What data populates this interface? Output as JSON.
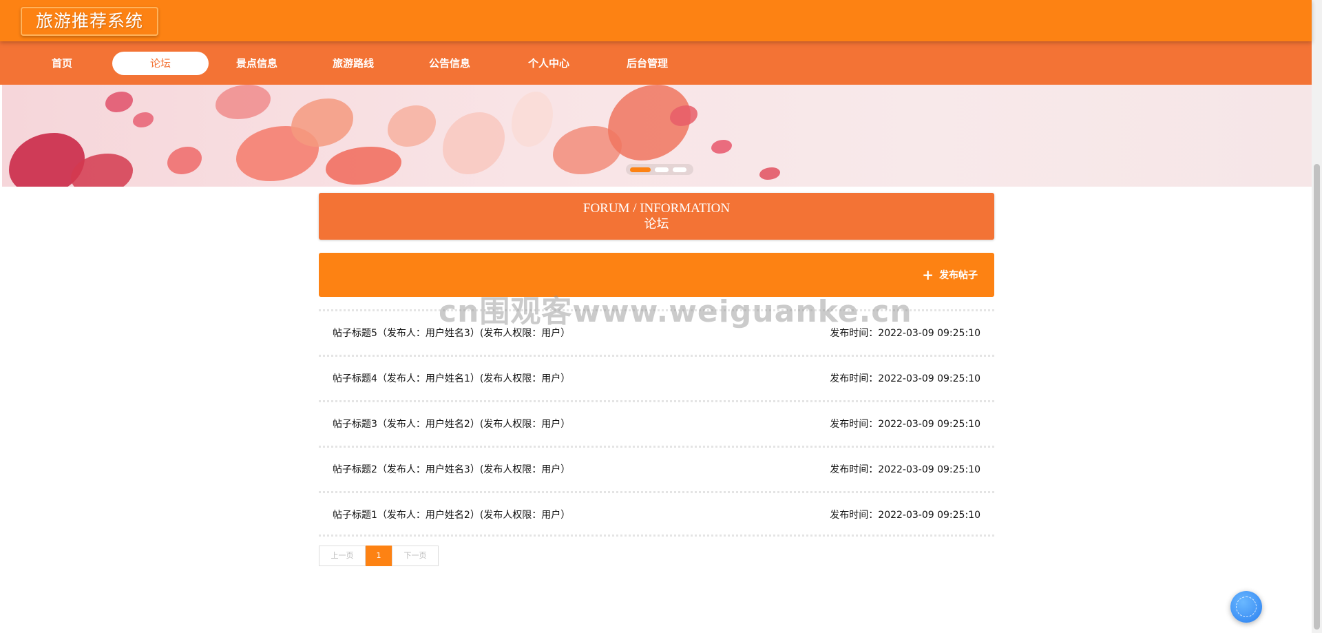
{
  "app": {
    "title": "旅游推荐系统"
  },
  "nav": {
    "items": [
      {
        "label": "首页"
      },
      {
        "label": "论坛"
      },
      {
        "label": "景点信息"
      },
      {
        "label": "旅游路线"
      },
      {
        "label": "公告信息"
      },
      {
        "label": "个人中心"
      },
      {
        "label": "后台管理"
      }
    ],
    "active_index": 1
  },
  "banner": {
    "slide_count": 3,
    "active_slide": 0
  },
  "section": {
    "title_en": "FORUM / INFORMATION",
    "title_cn": "论坛"
  },
  "actions": {
    "publish_label": "发布帖子",
    "publish_icon": "plus-icon"
  },
  "watermark": "cn围观客www.weiguanke.cn",
  "posts": [
    {
      "title": "帖子标题5（发布人：用户姓名3）(发布人权限：用户）",
      "time_label": "发布时间：2022-03-09 09:25:10"
    },
    {
      "title": "帖子标题4（发布人：用户姓名1）(发布人权限：用户）",
      "time_label": "发布时间：2022-03-09 09:25:10"
    },
    {
      "title": "帖子标题3（发布人：用户姓名2）(发布人权限：用户）",
      "time_label": "发布时间：2022-03-09 09:25:10"
    },
    {
      "title": "帖子标题2（发布人：用户姓名3）(发布人权限：用户）",
      "time_label": "发布时间：2022-03-09 09:25:10"
    },
    {
      "title": "帖子标题1（发布人：用户姓名2）(发布人权限：用户）",
      "time_label": "发布时间：2022-03-09 09:25:10"
    }
  ],
  "pagination": {
    "prev_label": "上一页",
    "current_page": "1",
    "next_label": "下一页"
  },
  "colors": {
    "topbar": "#fd8213",
    "navbar": "#f37335",
    "accent": "#fd8213"
  }
}
